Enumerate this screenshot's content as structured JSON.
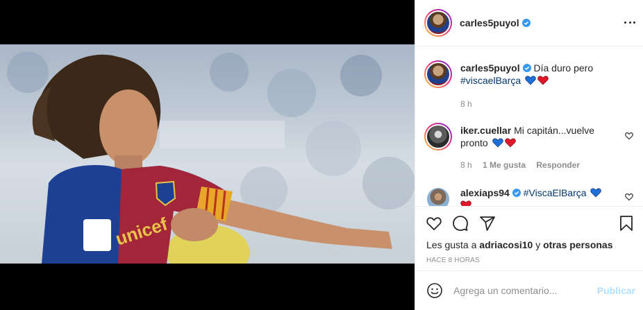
{
  "header": {
    "username": "carles5puyol"
  },
  "caption": {
    "username": "carles5puyol",
    "text": "Día duro pero",
    "hashtag": "#viscaelBarça",
    "time": "8 h"
  },
  "comments": [
    {
      "username": "iker.cuellar",
      "text": "Mi capitán...vuelve pronto",
      "time": "8 h",
      "likes": "1 Me gusta",
      "reply_label": "Responder"
    },
    {
      "username": "alexiaps94",
      "text": "",
      "hashtag": "#ViscaElBarça"
    }
  ],
  "likes": {
    "prefix": "Les gusta a",
    "user": "adriacosi10",
    "middle": "y",
    "others": "otras personas"
  },
  "timestamp": "HACE 8 HORAS",
  "add_comment": {
    "placeholder": "Agrega un comentario...",
    "publish_label": "Publicar"
  },
  "colors": {
    "link": "#00376b",
    "verified": "#3897f0",
    "publish_disabled": "#b2dffc",
    "heart_blue": "#1f6fd6",
    "heart_red": "#e0162b"
  }
}
